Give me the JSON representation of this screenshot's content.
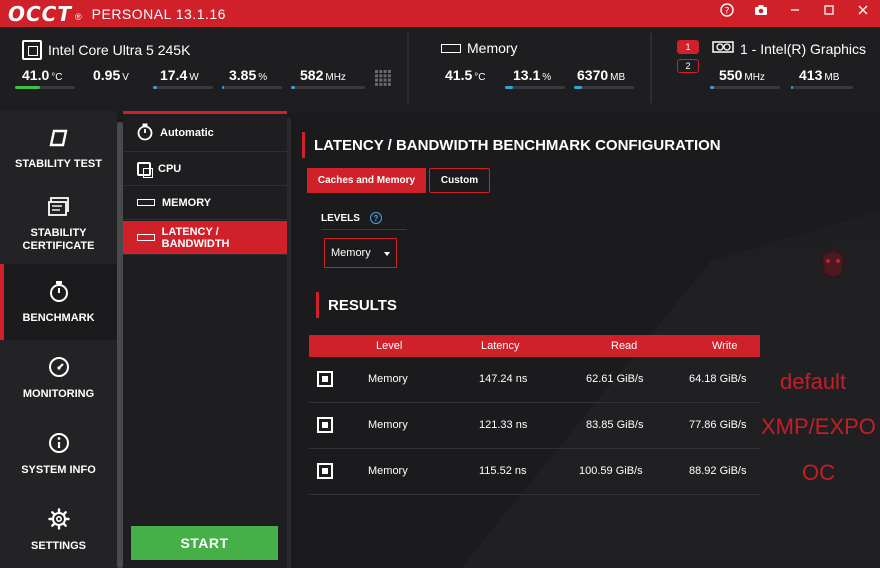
{
  "app": {
    "logo": "OCCT",
    "reg": "®",
    "edition": "PERSONAL 13.1.16"
  },
  "window_controls": {
    "help": "?",
    "camera": "◙",
    "minimize": "—",
    "maximize": "☐",
    "close": "✕"
  },
  "cpu": {
    "name": "Intel Core Ultra 5 245K",
    "temp": {
      "value": "41.0",
      "unit": "°C",
      "level": 0.42
    },
    "voltage": {
      "value": "0.95",
      "unit": "V"
    },
    "power": {
      "value": "17.4",
      "unit": "W",
      "level": 0.06
    },
    "load": {
      "value": "3.85",
      "unit": "%",
      "level": 0.04
    },
    "clock": {
      "value": "582",
      "unit": "MHz",
      "level": 0.06
    }
  },
  "memory": {
    "name": "Memory",
    "temp": {
      "value": "41.5",
      "unit": "°C",
      "level": 0.0
    },
    "usage": {
      "value": "13.1",
      "unit": "%",
      "level": 0.13
    },
    "used": {
      "value": "6370",
      "unit": "MB",
      "level": 0.13
    }
  },
  "gpu": {
    "badges": [
      "1",
      "2"
    ],
    "name": "1 - Intel(R) Graphics",
    "clock": {
      "value": "550",
      "unit": "MHz",
      "level": 0.05
    },
    "mem": {
      "value": "413",
      "unit": "MB",
      "level": 0.03
    }
  },
  "nav": {
    "items": [
      {
        "label": "STABILITY TEST",
        "icon": "stability-test-icon"
      },
      {
        "label": "STABILITY CERTIFICATE",
        "icon": "certificate-icon"
      },
      {
        "label": "BENCHMARK",
        "icon": "stopwatch-icon"
      },
      {
        "label": "MONITORING",
        "icon": "gauge-icon"
      },
      {
        "label": "SYSTEM INFO",
        "icon": "info-icon"
      },
      {
        "label": "SETTINGS",
        "icon": "gear-icon"
      }
    ]
  },
  "subnav": {
    "items": [
      {
        "label": "Automatic",
        "icon": "stopwatch-icon"
      },
      {
        "label": "CPU",
        "icon": "cpu-icon"
      },
      {
        "label": "MEMORY",
        "icon": "memory-icon"
      },
      {
        "label": "LATENCY / BANDWIDTH",
        "icon": "memory-icon"
      }
    ],
    "start": "START"
  },
  "config": {
    "title": "LATENCY / BANDWIDTH BENCHMARK CONFIGURATION",
    "tabs": [
      "Caches and Memory",
      "Custom"
    ],
    "levels_label": "LEVELS",
    "help": "?",
    "levels_value": "Memory"
  },
  "results": {
    "title": "RESULTS",
    "columns": [
      "Level",
      "Latency",
      "Read",
      "Write"
    ],
    "rows": [
      {
        "level": "Memory",
        "latency": "147.24 ns",
        "read": "62.61 GiB/s",
        "write": "64.18 GiB/s"
      },
      {
        "level": "Memory",
        "latency": "121.33 ns",
        "read": "83.85 GiB/s",
        "write": "77.86 GiB/s"
      },
      {
        "level": "Memory",
        "latency": "115.52 ns",
        "read": "100.59 GiB/s",
        "write": "88.92 GiB/s"
      }
    ],
    "notes": [
      "default",
      "XMP/EXPO",
      "OC"
    ]
  },
  "colors": {
    "accent": "#d0202a",
    "start": "#44b047",
    "bar_green": "#3ec24a",
    "bar_blue": "#3aa2d6",
    "note": "#c41e26"
  }
}
